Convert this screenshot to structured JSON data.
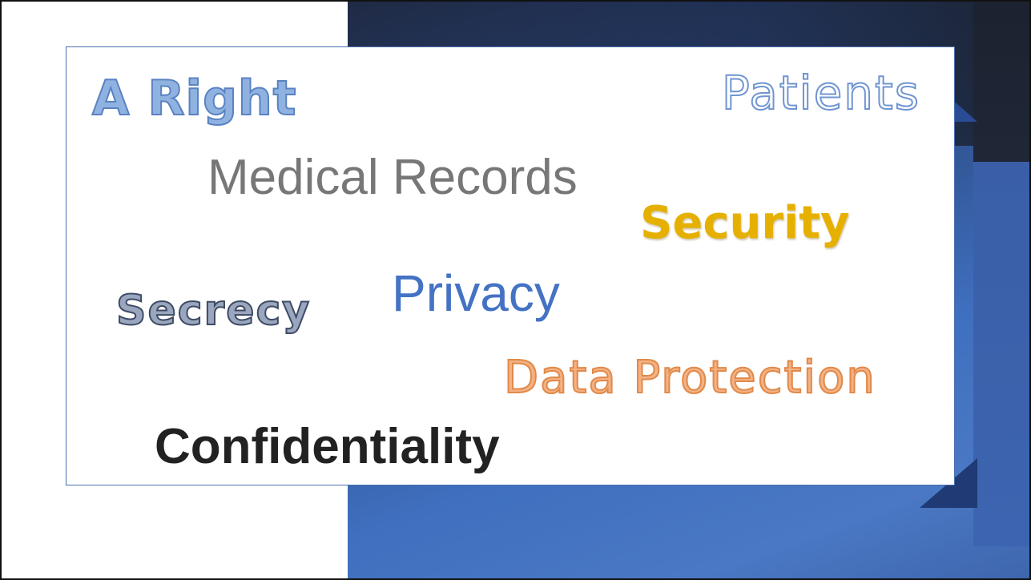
{
  "slide": {
    "words": {
      "a_right": "A Right",
      "patients": "Patients",
      "medical_records": "Medical Records",
      "security": "Security",
      "secrecy": "Secrecy",
      "privacy": "Privacy",
      "data_protection": "Data Protection",
      "confidentiality": "Confidentiality"
    },
    "colors": {
      "background_panel": "#3f6fbf",
      "dark_top": "#1f2a44",
      "security": "#e6b000",
      "privacy": "#4472c4",
      "data_protection": "#f4b183",
      "confidentiality": "#222222",
      "medical_records": "#777777"
    }
  }
}
